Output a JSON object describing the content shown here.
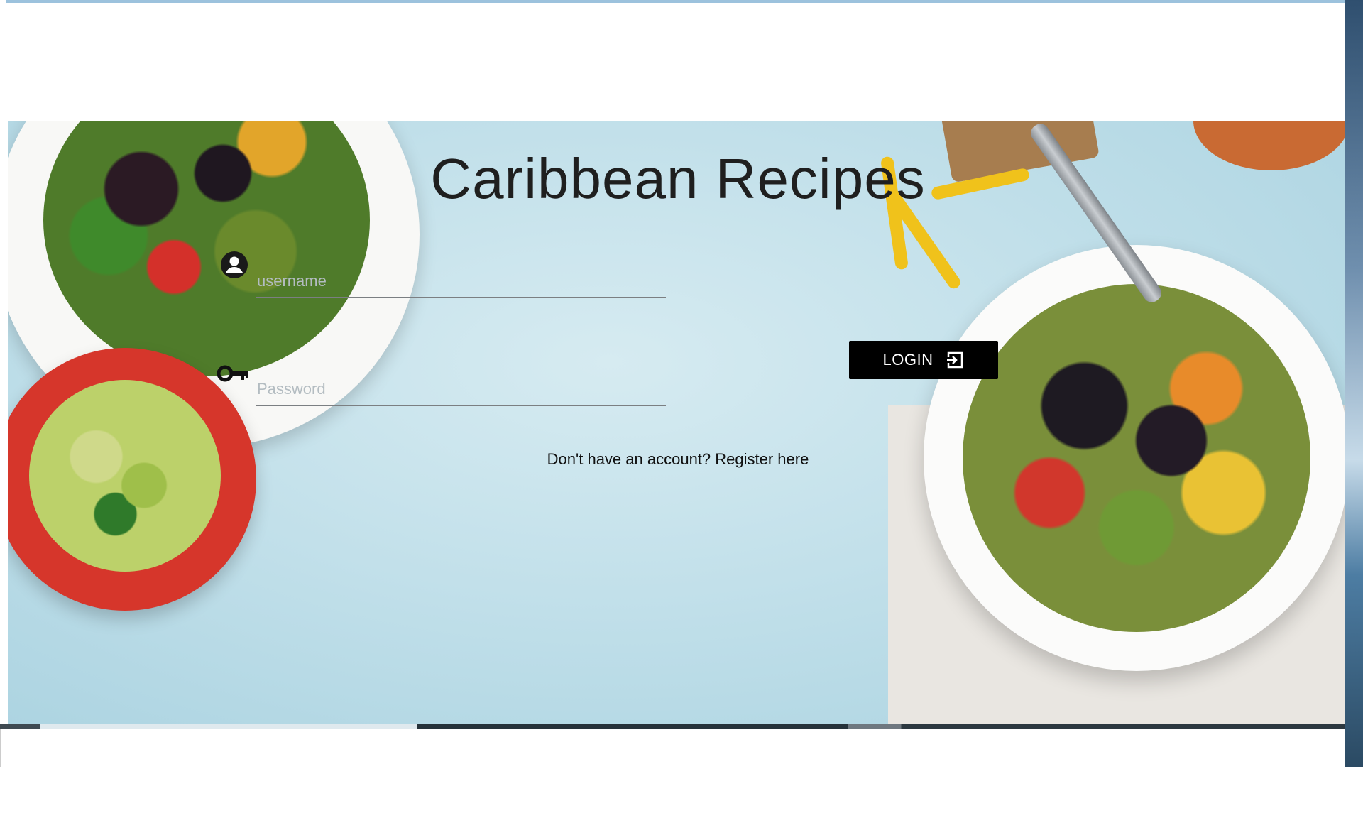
{
  "app": {
    "title": "Caribbean Recipes"
  },
  "login_form": {
    "username_placeholder": "username",
    "password_placeholder": "Password",
    "login_label": "LOGIN",
    "register_text": "Don't have an account? Register here"
  },
  "icons": {
    "username": "user-circle-icon",
    "password": "key-icon",
    "login": "login-arrow-icon"
  },
  "colors": {
    "background": "#c2e0ea",
    "title_text": "#1f1f1f",
    "button": "#000000",
    "button_text": "#ffffff"
  }
}
